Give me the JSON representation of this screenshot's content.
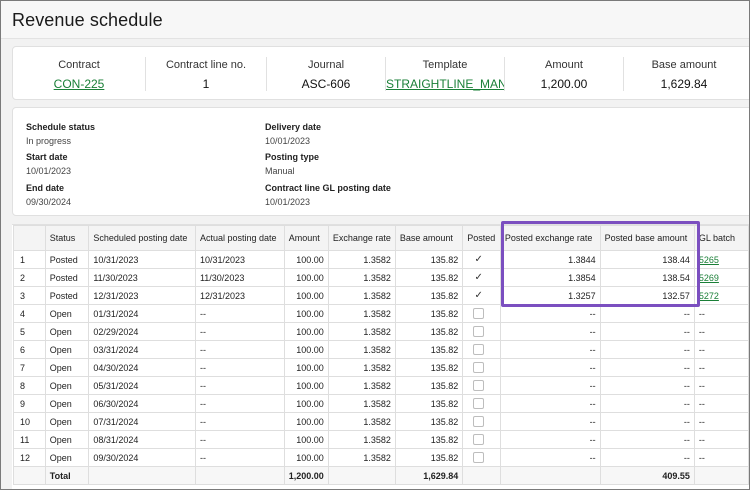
{
  "page": {
    "title": "Revenue schedule"
  },
  "summary": {
    "contract": {
      "label": "Contract",
      "value": "CON-225"
    },
    "contract_line": {
      "label": "Contract line no.",
      "value": "1"
    },
    "journal": {
      "label": "Journal",
      "value": "ASC-606"
    },
    "template": {
      "label": "Template",
      "value": "STRAIGHTLINE_MANUA"
    },
    "amount": {
      "label": "Amount",
      "value": "1,200.00"
    },
    "base_amount": {
      "label": "Base amount",
      "value": "1,629.84"
    }
  },
  "details": {
    "schedule_status": {
      "label": "Schedule status",
      "value": "In progress"
    },
    "start_date": {
      "label": "Start date",
      "value": "10/01/2023"
    },
    "end_date": {
      "label": "End date",
      "value": "09/30/2024"
    },
    "delivery_date": {
      "label": "Delivery date",
      "value": "10/01/2023"
    },
    "posting_type": {
      "label": "Posting type",
      "value": "Manual"
    },
    "gl_posting_date": {
      "label": "Contract line GL posting date",
      "value": "10/01/2023"
    }
  },
  "table": {
    "headers": [
      "",
      "Status",
      "Scheduled posting date",
      "Actual posting date",
      "Amount",
      "Exchange rate",
      "Base amount",
      "Posted",
      "Posted exchange rate",
      "Posted base amount",
      "GL batch"
    ],
    "rows": [
      {
        "n": "1",
        "status": "Posted",
        "sched": "10/31/2023",
        "actual": "10/31/2023",
        "amount": "100.00",
        "rate": "1.3582",
        "base": "135.82",
        "posted": true,
        "prate": "1.3844",
        "pbase": "138.44",
        "gl": "5265"
      },
      {
        "n": "2",
        "status": "Posted",
        "sched": "11/30/2023",
        "actual": "11/30/2023",
        "amount": "100.00",
        "rate": "1.3582",
        "base": "135.82",
        "posted": true,
        "prate": "1.3854",
        "pbase": "138.54",
        "gl": "5269"
      },
      {
        "n": "3",
        "status": "Posted",
        "sched": "12/31/2023",
        "actual": "12/31/2023",
        "amount": "100.00",
        "rate": "1.3582",
        "base": "135.82",
        "posted": true,
        "prate": "1.3257",
        "pbase": "132.57",
        "gl": "5272"
      },
      {
        "n": "4",
        "status": "Open",
        "sched": "01/31/2024",
        "actual": "--",
        "amount": "100.00",
        "rate": "1.3582",
        "base": "135.82",
        "posted": false,
        "prate": "--",
        "pbase": "--",
        "gl": "--"
      },
      {
        "n": "5",
        "status": "Open",
        "sched": "02/29/2024",
        "actual": "--",
        "amount": "100.00",
        "rate": "1.3582",
        "base": "135.82",
        "posted": false,
        "prate": "--",
        "pbase": "--",
        "gl": "--"
      },
      {
        "n": "6",
        "status": "Open",
        "sched": "03/31/2024",
        "actual": "--",
        "amount": "100.00",
        "rate": "1.3582",
        "base": "135.82",
        "posted": false,
        "prate": "--",
        "pbase": "--",
        "gl": "--"
      },
      {
        "n": "7",
        "status": "Open",
        "sched": "04/30/2024",
        "actual": "--",
        "amount": "100.00",
        "rate": "1.3582",
        "base": "135.82",
        "posted": false,
        "prate": "--",
        "pbase": "--",
        "gl": "--"
      },
      {
        "n": "8",
        "status": "Open",
        "sched": "05/31/2024",
        "actual": "--",
        "amount": "100.00",
        "rate": "1.3582",
        "base": "135.82",
        "posted": false,
        "prate": "--",
        "pbase": "--",
        "gl": "--"
      },
      {
        "n": "9",
        "status": "Open",
        "sched": "06/30/2024",
        "actual": "--",
        "amount": "100.00",
        "rate": "1.3582",
        "base": "135.82",
        "posted": false,
        "prate": "--",
        "pbase": "--",
        "gl": "--"
      },
      {
        "n": "10",
        "status": "Open",
        "sched": "07/31/2024",
        "actual": "--",
        "amount": "100.00",
        "rate": "1.3582",
        "base": "135.82",
        "posted": false,
        "prate": "--",
        "pbase": "--",
        "gl": "--"
      },
      {
        "n": "11",
        "status": "Open",
        "sched": "08/31/2024",
        "actual": "--",
        "amount": "100.00",
        "rate": "1.3582",
        "base": "135.82",
        "posted": false,
        "prate": "--",
        "pbase": "--",
        "gl": "--"
      },
      {
        "n": "12",
        "status": "Open",
        "sched": "09/30/2024",
        "actual": "--",
        "amount": "100.00",
        "rate": "1.3582",
        "base": "135.82",
        "posted": false,
        "prate": "--",
        "pbase": "--",
        "gl": "--"
      }
    ],
    "total": {
      "label": "Total",
      "amount": "1,200.00",
      "base": "1,629.84",
      "pbase": "409.55"
    },
    "checkmark_glyph": "✓"
  },
  "colors": {
    "link": "#1a7f37",
    "highlight": "#7b4fc0"
  }
}
